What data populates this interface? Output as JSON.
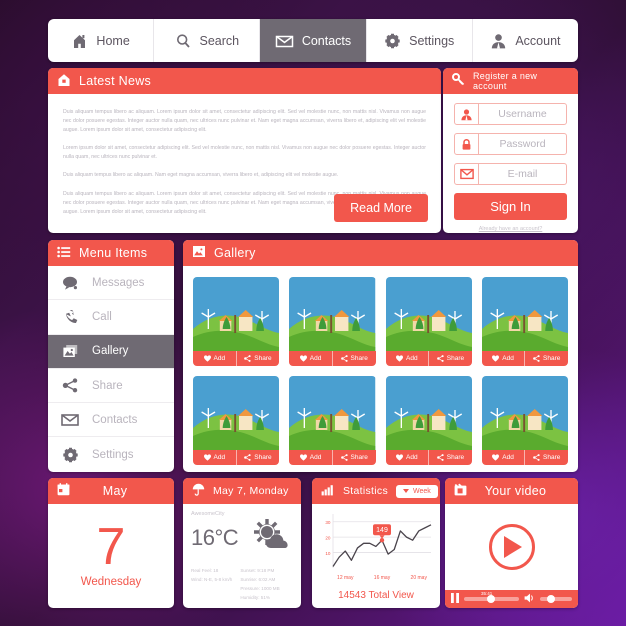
{
  "theme": {
    "accent": "#f2574c",
    "dark": "#6f6a73",
    "muted": "#b9b4bd"
  },
  "topnav": {
    "items": [
      {
        "label": "Home",
        "icon": "home-icon",
        "active": false
      },
      {
        "label": "Search",
        "icon": "search-icon",
        "active": false
      },
      {
        "label": "Contacts",
        "icon": "envelope-icon",
        "active": true
      },
      {
        "label": "Settings",
        "icon": "gear-icon",
        "active": false
      },
      {
        "label": "Account",
        "icon": "user-icon",
        "active": false
      }
    ]
  },
  "news": {
    "title": "Latest News",
    "icon": "home-icon",
    "paragraphs": [
      "Duis aliquam tempus libero ac aliquam. Lorem ipsum dolor sit amet, consectetur adipiscing elit. Sed vel molestie nunc, non mattis nisl. Vivamus non augue nec dolor posuere egestas. Integer auctor nulla quam, nec ultrices nunc pulvinar et. Nam eget magna accumsan, viverra libero et, adipiscing elit vel molestie augue. Lorem ipsum dolor sit amet, consectetur adipiscing elit.",
      "Lorem ipsum dolor sit amet, consectetur adipiscing elit. Sed vel molestie nunc, non mattis nisl. Vivamus non augue nec dolor posuere egestas. Integer auctor nulla quam, nec ultrices nunc pulvinar et.",
      "Duis aliquam tempus libero ac aliquam. Nam eget magna accumsan, viverra libero et, adipiscing elit vel molestie augue.",
      "Duis aliquam tempus libero ac aliquam. Lorem ipsum dolor sit amet, consectetur adipiscing elit. Sed vel molestie nunc, non mattis nisl. Vivamus non augue nec dolor posuere egestas. Integer auctor nulla quam, nec ultrices nunc pulvinar et. Nam eget magna accumsan, viverra libero et, adipiscing elit vel molestie augue. Lorem ipsum dolor sit amet, consectetur adipiscing elit."
    ],
    "read_more": "Read More"
  },
  "register": {
    "title": "Register a new account",
    "icon": "key-icon",
    "fields": [
      {
        "placeholder": "Username",
        "icon": "user-icon"
      },
      {
        "placeholder": "Password",
        "icon": "lock-icon"
      },
      {
        "placeholder": "E-mail",
        "icon": "envelope-icon"
      }
    ],
    "submit": "Sign In",
    "already_link": "Already have an account?"
  },
  "menu": {
    "title": "Menu Items",
    "icon": "list-icon",
    "items": [
      {
        "label": "Messages",
        "icon": "speech-bubble-icon",
        "active": false
      },
      {
        "label": "Call",
        "icon": "phone-icon",
        "active": false
      },
      {
        "label": "Gallery",
        "icon": "photos-icon",
        "active": true
      },
      {
        "label": "Share",
        "icon": "share-icon",
        "active": false
      },
      {
        "label": "Contacts",
        "icon": "envelope-icon",
        "active": false
      },
      {
        "label": "Settings",
        "icon": "gear-icon",
        "active": false
      }
    ]
  },
  "gallery": {
    "title": "Gallery",
    "icon": "photos-icon",
    "add_label": "Add",
    "share_label": "Share",
    "items": [
      {
        "alt": "countryside-landscape"
      },
      {
        "alt": "countryside-landscape"
      },
      {
        "alt": "countryside-landscape"
      },
      {
        "alt": "countryside-landscape"
      },
      {
        "alt": "countryside-landscape"
      },
      {
        "alt": "countryside-landscape"
      },
      {
        "alt": "countryside-landscape"
      },
      {
        "alt": "countryside-landscape"
      }
    ]
  },
  "calendar": {
    "title": "May",
    "icon": "calendar-icon",
    "day_number": "7",
    "weekday": "Wednesday"
  },
  "weather": {
    "title": "May 7, Monday",
    "icon": "umbrella-icon",
    "city": "AwesomeCity",
    "temperature": "16°C",
    "condition_icon": "sun-cloud-icon",
    "left_stats": [
      "Real Feel: 18",
      "Wind: N-E, 5-8 km/h"
    ],
    "right_stats": [
      "Sunset: 9:18 PM",
      "Sunrise: 6:02 AM",
      "Pressure: 1000 MB",
      "Humidity: 51%"
    ]
  },
  "statistics": {
    "title": "Statistics",
    "icon": "bar-chart-icon",
    "range_label": "Week",
    "total_view": "14543 Total View",
    "chart_data": {
      "type": "line",
      "title": "Statistics",
      "xlabel": "",
      "ylabel": "",
      "ylim": [
        0,
        35
      ],
      "yticks": [
        10,
        20,
        30
      ],
      "grid": true,
      "legend": false,
      "tick_labels": [
        "12 may",
        "16 may",
        "20 may"
      ],
      "annotation": {
        "label": "149",
        "x_index": 8,
        "y": 18
      },
      "x": [
        0,
        1,
        2,
        3,
        4,
        5,
        6,
        7,
        8,
        9,
        10,
        11,
        12,
        13,
        14,
        15,
        16
      ],
      "values": [
        1,
        7,
        11,
        5,
        13,
        16,
        16,
        14,
        18,
        9,
        12,
        24,
        20,
        18,
        24,
        26,
        28
      ]
    }
  },
  "video": {
    "title": "Your video",
    "icon": "film-icon",
    "play_icon": "play-icon",
    "pause_icon": "pause-icon",
    "volume_icon": "volume-icon",
    "timestamp": "35:41",
    "progress_percent": 42,
    "volume_percent": 22
  }
}
